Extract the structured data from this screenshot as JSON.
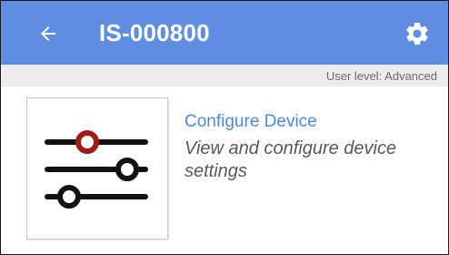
{
  "app_bar": {
    "title": "IS-000800",
    "back_icon": "arrow-left-icon",
    "settings_icon": "gear-icon",
    "background": "#5f8ee0"
  },
  "status": {
    "user_level": "User level: Advanced"
  },
  "card": {
    "icon": "sliders-icon",
    "accent": "#a11a1a",
    "title": "Configure Device",
    "description": "View and configure device settings"
  }
}
